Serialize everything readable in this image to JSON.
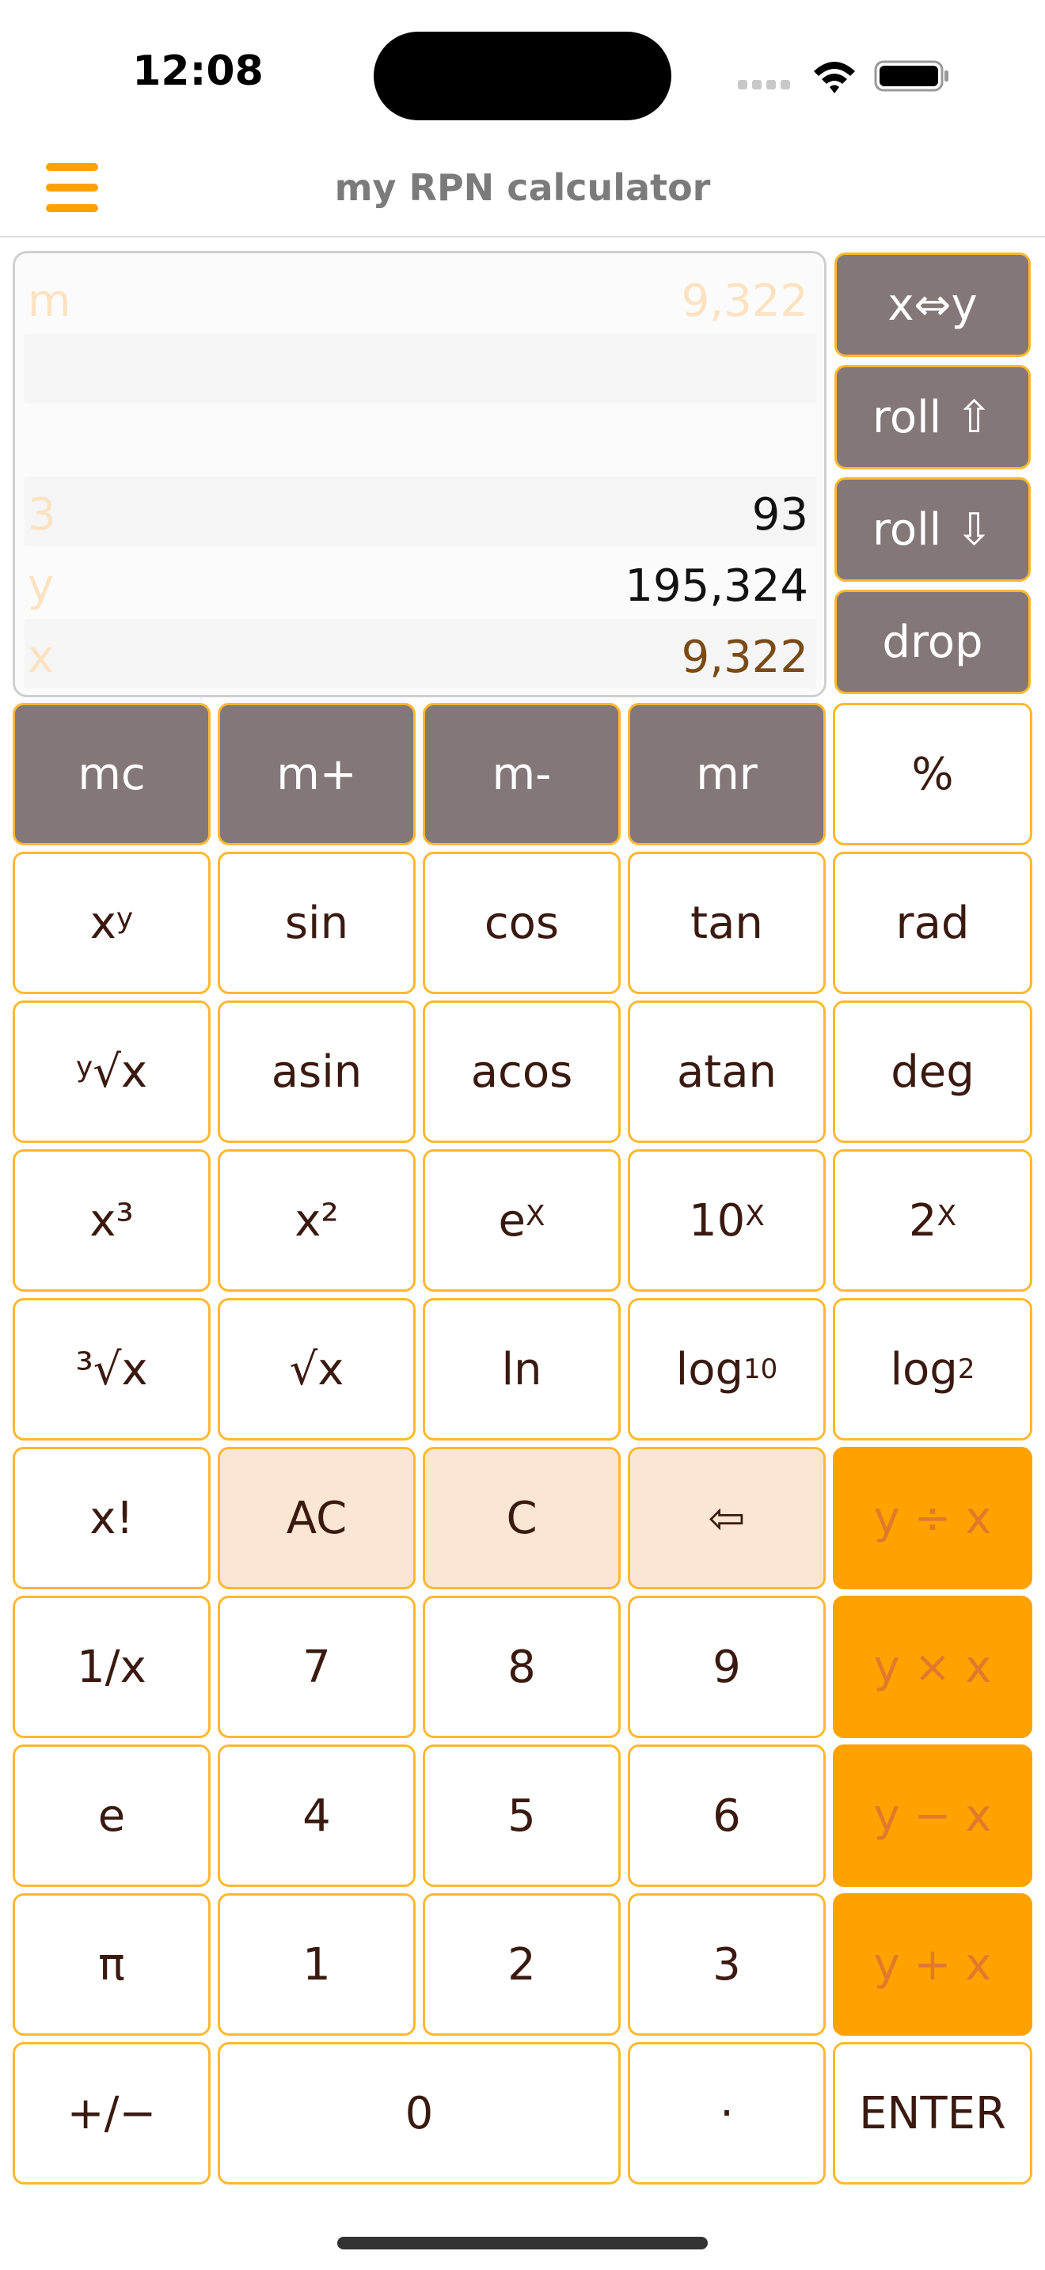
{
  "status": {
    "time": "12:08"
  },
  "nav": {
    "title": "my RPN calculator"
  },
  "stack": {
    "rows": [
      {
        "label": "m",
        "value": "9,322"
      },
      {
        "label": "",
        "value": ""
      },
      {
        "label": "",
        "value": ""
      },
      {
        "label": "3",
        "value": "93"
      },
      {
        "label": "y",
        "value": "195,324"
      },
      {
        "label": "x",
        "value": "9,322"
      }
    ]
  },
  "stack_ops": {
    "swap": "x⇔y",
    "roll_up": "roll ⇧",
    "roll_down": "roll ⇩",
    "drop": "drop"
  },
  "keys": {
    "mc": "mc",
    "mplus": "m+",
    "mminus": "m-",
    "mr": "mr",
    "percent": "%",
    "pow_base": "x",
    "pow_exp": "y",
    "sin": "sin",
    "cos": "cos",
    "tan": "tan",
    "rad": "rad",
    "yroot_idx": "y",
    "yroot_rad": "√x",
    "asin": "asin",
    "acos": "acos",
    "atan": "atan",
    "deg": "deg",
    "cube": "x³",
    "square": "x²",
    "exp_base": "e",
    "exp_x": "X",
    "ten_base": "10",
    "ten_x": "X",
    "two_base": "2",
    "two_x": "X",
    "cbrt": "³√x",
    "sqrt": "√x",
    "ln": "ln",
    "log10_base": "log",
    "log10_sub": "10",
    "log2_base": "log",
    "log2_sub": "2",
    "fact": "x!",
    "ac": "AC",
    "c": "C",
    "back": "⇦",
    "div": "y ÷ x",
    "recip": "1/x",
    "seven": "7",
    "eight": "8",
    "nine": "9",
    "mul": "y × x",
    "e": "e",
    "four": "4",
    "five": "5",
    "six": "6",
    "sub": "y − x",
    "pi": "π",
    "one": "1",
    "two": "2",
    "three": "3",
    "add": "y + x",
    "neg": "+/−",
    "zero": "0",
    "dot": "·",
    "enter": "ENTER"
  }
}
